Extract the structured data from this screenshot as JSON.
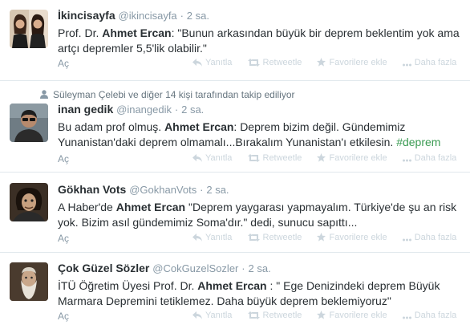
{
  "tweets": [
    {
      "fullname": "İkincisayfa",
      "username": "@ikincisayfa",
      "separator": "·",
      "time": "2 sa.",
      "text_before": "Prof. Dr. ",
      "text_bold": "Ahmet Ercan",
      "text_after": ": \"Bunun arkasından büyük bir deprem beklentim yok ama artçı depremler 5,5'lik olabilir.\"",
      "open_label": "Aç"
    },
    {
      "fullname": "inan gedik",
      "username": "@inangedik",
      "separator": "·",
      "time": "2 sa.",
      "text_before": "Bu adam prof olmuş. ",
      "text_bold": "Ahmet Ercan",
      "text_after": ": Deprem bizim değil. Gündemimiz Yunanistan'daki deprem olmamalı...Bırakalım Yunanistan'ı etkilesin. ",
      "hashtag": "#deprem",
      "open_label": "Aç"
    },
    {
      "fullname": "Gökhan Vots",
      "username": "@GokhanVots",
      "separator": "·",
      "time": "2 sa.",
      "text_before": "A Haber'de ",
      "text_bold": "Ahmet Ercan",
      "text_after": " \"Deprem yaygarası yapmayalım. Türkiye'de şu an risk yok. Bizim asıl gündemimiz Soma'dır.\" dedi, sunucu sapıttı...",
      "open_label": "Aç"
    },
    {
      "fullname": "Çok Güzel Sözler",
      "username": "@CokGuzelSozler",
      "separator": "·",
      "time": "2 sa.",
      "text_before": "İTÜ Öğretim Üyesi Prof. Dr. ",
      "text_bold": "Ahmet Ercan",
      "text_after": " : \" Ege Denizindeki deprem Büyük Marmara Depremini tetiklemez. Daha büyük deprem beklemiyoruz\"",
      "open_label": "Aç"
    }
  ],
  "context_line": "Süleyman Çelebi ve diğer 14 kişi tarafından takip ediliyor",
  "actions": {
    "reply": "Yanıtla",
    "retweet": "Retweetle",
    "favorite": "Favorilere ekle",
    "more": "Daha fazla"
  },
  "colors": {
    "hashtag": "#3b9b53",
    "muted": "#8899a6",
    "action": "#ccd6dd",
    "text": "#292f33",
    "divider": "#e1e8ed"
  }
}
